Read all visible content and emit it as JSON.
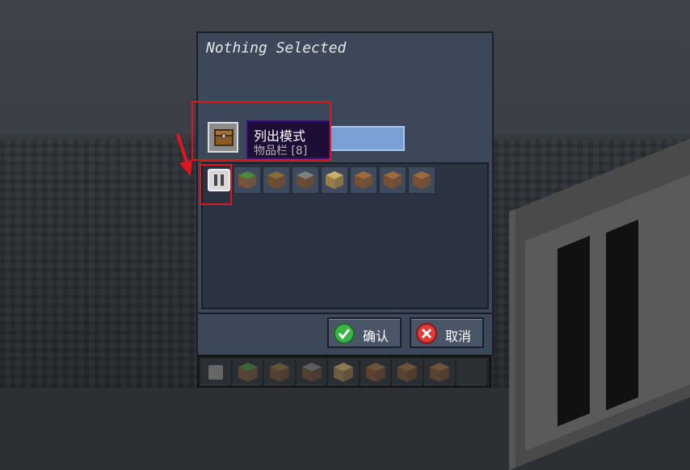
{
  "dialog": {
    "title": "Nothing Selected",
    "tooltip": {
      "title": "列出模式",
      "subtitle": "物品栏 [8]"
    },
    "slots": [
      {
        "block": "grass-block-icon",
        "top": "#4b8a3a",
        "side": "#7a5535"
      },
      {
        "block": "dirt-block-icon",
        "top": "#8a6a3a",
        "side": "#6f4e2e"
      },
      {
        "block": "podzol-block-icon",
        "top": "#7f7f7f",
        "side": "#6b4c30"
      },
      {
        "block": "sand-block-icon",
        "top": "#c9ad6a",
        "side": "#9a7c46"
      },
      {
        "block": "dirt-block-icon",
        "top": "#9b6b3f",
        "side": "#7a5030"
      },
      {
        "block": "dirt-block-icon",
        "top": "#9b6b3f",
        "side": "#7a5030"
      },
      {
        "block": "dirt-block-icon",
        "top": "#9b6b3f",
        "side": "#7a5030"
      }
    ],
    "confirm_label": "确认",
    "cancel_label": "取消"
  },
  "colors": {
    "confirm_icon": "#3bb54a",
    "cancel_icon": "#e23b3b",
    "highlight": "#e0151f"
  }
}
